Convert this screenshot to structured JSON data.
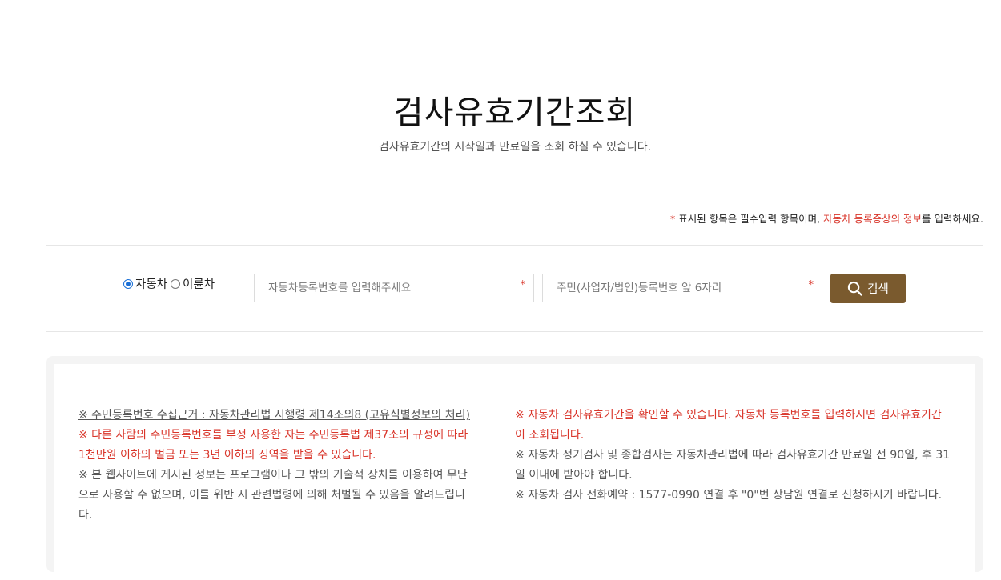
{
  "header": {
    "title": "검사유효기간조회",
    "subtitle": "검사유효기간의 시작일과 만료일을 조회 하실 수 있습니다."
  },
  "notice": {
    "star": "*",
    "text1": " 표시된 항목은 필수입력 항목이며, ",
    "highlight": "자동차 등록증상의 정보",
    "text2": "를 입력하세요."
  },
  "search": {
    "vehicle_types": [
      {
        "label": "자동차",
        "checked": true
      },
      {
        "label": "이륜차",
        "checked": false
      }
    ],
    "car_number_placeholder": "자동차등록번호를 입력해주세요",
    "ssn_placeholder": "주민(사업자/법인)등록번호 앞 6자리",
    "required_mark": "*",
    "button_label": "검색"
  },
  "info": {
    "left": [
      "※ 주민등록번호 수집근거 : 자동차관리법 시행령 제14조의8 (고유식별정보의 처리)",
      "※ 다른 사람의 주민등록번호를 부정 사용한 자는 주민등록법 제37조의 규정에 따라 1천만원 이하의 벌금 또는 3년 이하의 징역을 받을 수 있습니다.",
      "※ 본 웹사이트에 게시된 정보는 프로그램이나 그 밖의 기술적 장치를 이용하여 무단으로 사용할 수 없으며, 이를 위반 시 관련법령에 의해 처벌될 수 있음을 알려드립니다."
    ],
    "right": [
      "※ 자동차 검사유효기간을 확인할 수 있습니다. 자동차 등록번호를 입력하시면 검사유효기간이 조회됩니다.",
      "※ 자동차 정기검사 및 종합검사는 자동차관리법에 따라 검사유효기간 만료일 전 90일, 후 31일 이내에 받아야 합니다.",
      "※ 자동차 검사 전화예약 : 1577-0990 연결 후 \"0\"번 상담원 연결로 신청하시기 바랍니다."
    ]
  },
  "colors": {
    "accent": "#7a5a2e",
    "warning": "#d9362b",
    "radio": "#1a6fd6"
  }
}
